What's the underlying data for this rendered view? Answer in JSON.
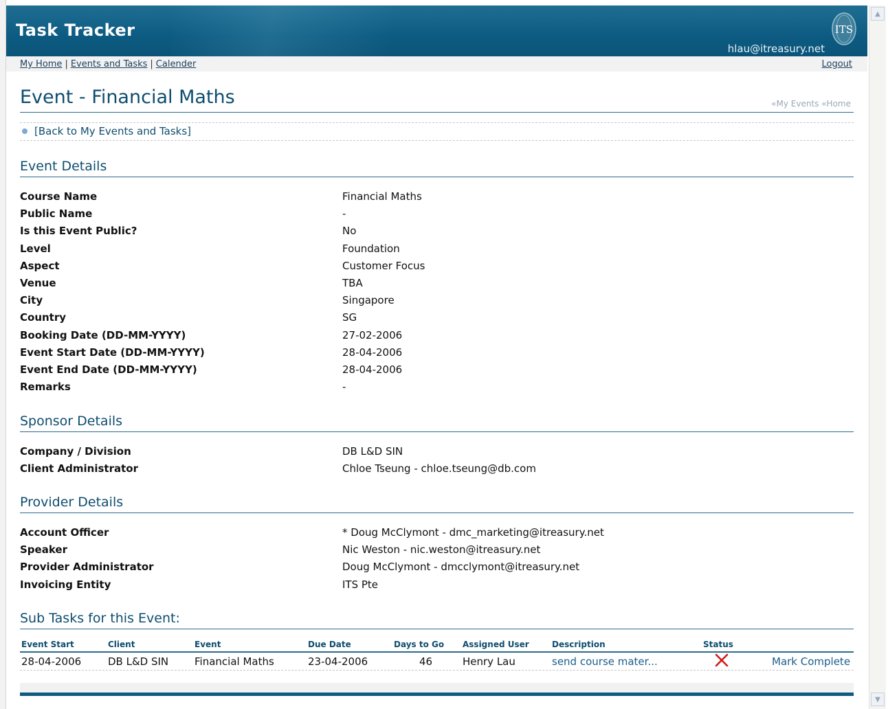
{
  "app": {
    "title": "Task Tracker",
    "user_email": "hlau@itreasury.net",
    "logo_text": "ITS"
  },
  "nav": {
    "links": [
      {
        "label": "My Home"
      },
      {
        "label": "Events and Tasks"
      },
      {
        "label": "Calender"
      }
    ],
    "separator": "|",
    "logout": "Logout"
  },
  "page": {
    "title": "Event - Financial Maths",
    "breadcrumbs": "«My Events «Home",
    "back_link": "[Back to My Events and Tasks]"
  },
  "event_details": {
    "heading": "Event Details",
    "rows": [
      {
        "label": "Course Name",
        "value": "Financial Maths"
      },
      {
        "label": "Public Name",
        "value": "-"
      },
      {
        "label": "Is this Event Public?",
        "value": "No"
      },
      {
        "label": "Level",
        "value": "Foundation"
      },
      {
        "label": "Aspect",
        "value": "Customer Focus"
      },
      {
        "label": "Venue",
        "value": "TBA"
      },
      {
        "label": "City",
        "value": "Singapore"
      },
      {
        "label": "Country",
        "value": "SG"
      },
      {
        "label": "Booking Date (DD-MM-YYYY)",
        "value": "27-02-2006"
      },
      {
        "label": "Event Start Date (DD-MM-YYYY)",
        "value": "28-04-2006"
      },
      {
        "label": "Event End Date (DD-MM-YYYY)",
        "value": "28-04-2006"
      },
      {
        "label": "Remarks",
        "value": "-"
      }
    ]
  },
  "sponsor_details": {
    "heading": "Sponsor Details",
    "rows": [
      {
        "label": "Company / Division",
        "value": "DB L&D SIN"
      },
      {
        "label": "Client Administrator",
        "value": "Chloe Tseung - chloe.tseung@db.com"
      }
    ]
  },
  "provider_details": {
    "heading": "Provider Details",
    "rows": [
      {
        "label": "Account Officer",
        "value": "* Doug McClymont - dmc_marketing@itreasury.net"
      },
      {
        "label": "Speaker",
        "value": "Nic Weston - nic.weston@itreasury.net"
      },
      {
        "label": "Provider Administrator",
        "value": "Doug McClymont - dmcclymont@itreasury.net"
      },
      {
        "label": "Invoicing Entity",
        "value": "ITS Pte"
      }
    ]
  },
  "subtasks": {
    "heading": "Sub Tasks for this Event:",
    "columns": [
      "Event Start",
      "Client",
      "Event",
      "Due Date",
      "Days to Go",
      "Assigned User",
      "Description",
      "Status"
    ],
    "rows": [
      {
        "event_start": "28-04-2006",
        "client": "DB L&D SIN",
        "event": "Financial Maths",
        "due_date": "23-04-2006",
        "days_to_go": "46",
        "assigned_user": "Henry Lau",
        "description": "send course mater...",
        "status_icon": "red-x-icon",
        "action": "Mark Complete"
      }
    ]
  },
  "colors": {
    "header_bg": "#0d5b82",
    "heading": "#0e4d6e",
    "status_red": "#d11a1a"
  }
}
